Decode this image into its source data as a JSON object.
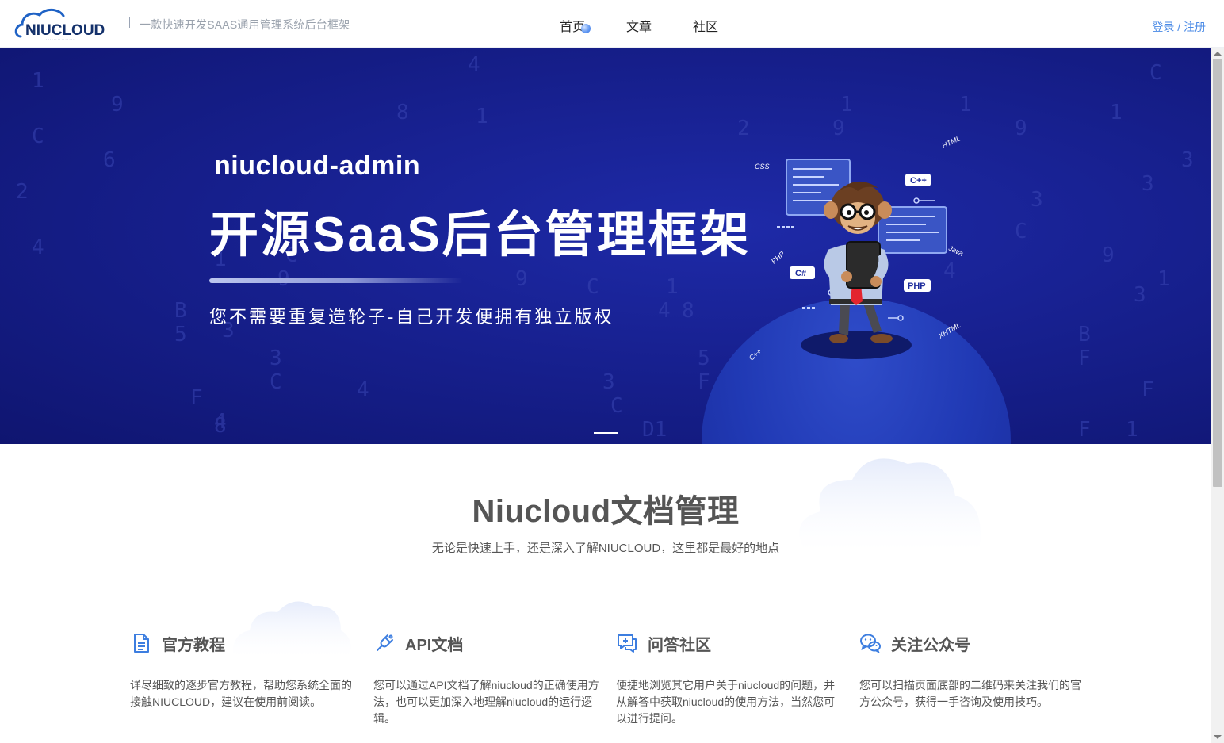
{
  "header": {
    "logo_text": "NIUCLOUD",
    "slogan": "一款快速开发SAAS通用管理系统后台框架",
    "nav": [
      {
        "label": "首页",
        "active": true
      },
      {
        "label": "文章",
        "active": false
      },
      {
        "label": "社区",
        "active": false
      }
    ],
    "auth_label": "登录 / 注册"
  },
  "banner": {
    "sub_title": "niucloud-admin",
    "title": "开源SaaS后台管理框架",
    "slogan": "您不需要重复造轮子-自己开发便拥有独立版权",
    "tags": [
      "CSS",
      "HTML",
      "C++",
      "PHP",
      "C#",
      "PHP",
      "Java",
      "C++",
      "XHTML"
    ],
    "background_color": "#17208f"
  },
  "section": {
    "title": "Niucloud文档管理",
    "subtitle": "无论是快速上手，还是深入了解NIUCLOUD，这里都是最好的地点"
  },
  "cards": [
    {
      "icon": "document-icon",
      "title": "官方教程",
      "desc": "详尽细致的逐步官方教程，帮助您系统全面的接触NIUCLOUD，建议在使用前阅读。"
    },
    {
      "icon": "plug-icon",
      "title": "API文档",
      "desc": "您可以通过API文档了解niucloud的正确使用方法，也可以更加深入地理解niucloud的运行逻辑。"
    },
    {
      "icon": "chat-icon",
      "title": "问答社区",
      "desc": "便捷地浏览其它用户关于niucloud的问题，并从解答中获取niucloud的使用方法，当然您可以进行提问。"
    },
    {
      "icon": "wechat-icon",
      "title": "关注公众号",
      "desc": "您可以扫描页面底部的二维码来关注我们的官方公众号，获得一手咨询及使用技巧。"
    }
  ],
  "colors": {
    "accent": "#4a8ae6",
    "icon": "#3d7ee0",
    "banner": "#17208f"
  }
}
